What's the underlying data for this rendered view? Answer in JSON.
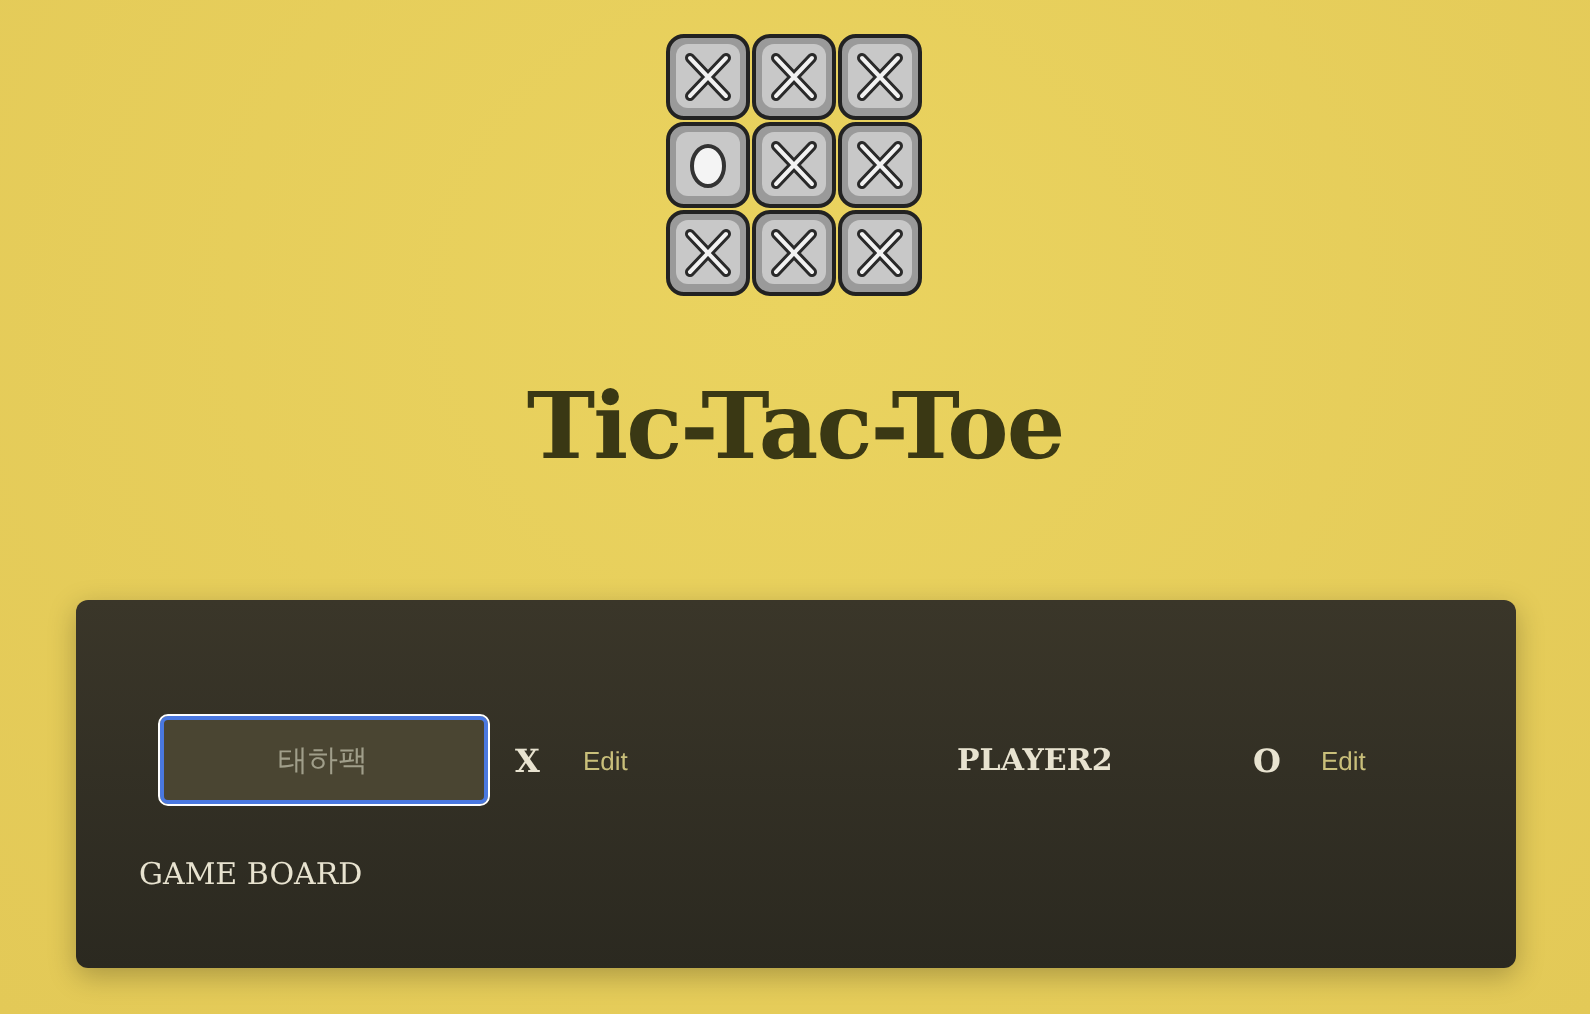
{
  "title": "Tic-Tac-Toe",
  "players": [
    {
      "name": "태하팩",
      "symbol": "X",
      "editing": true,
      "action": "Edit"
    },
    {
      "name": "PLAYER2",
      "symbol": "O",
      "editing": false,
      "action": "Edit"
    }
  ],
  "board_heading": "GAME BOARD"
}
